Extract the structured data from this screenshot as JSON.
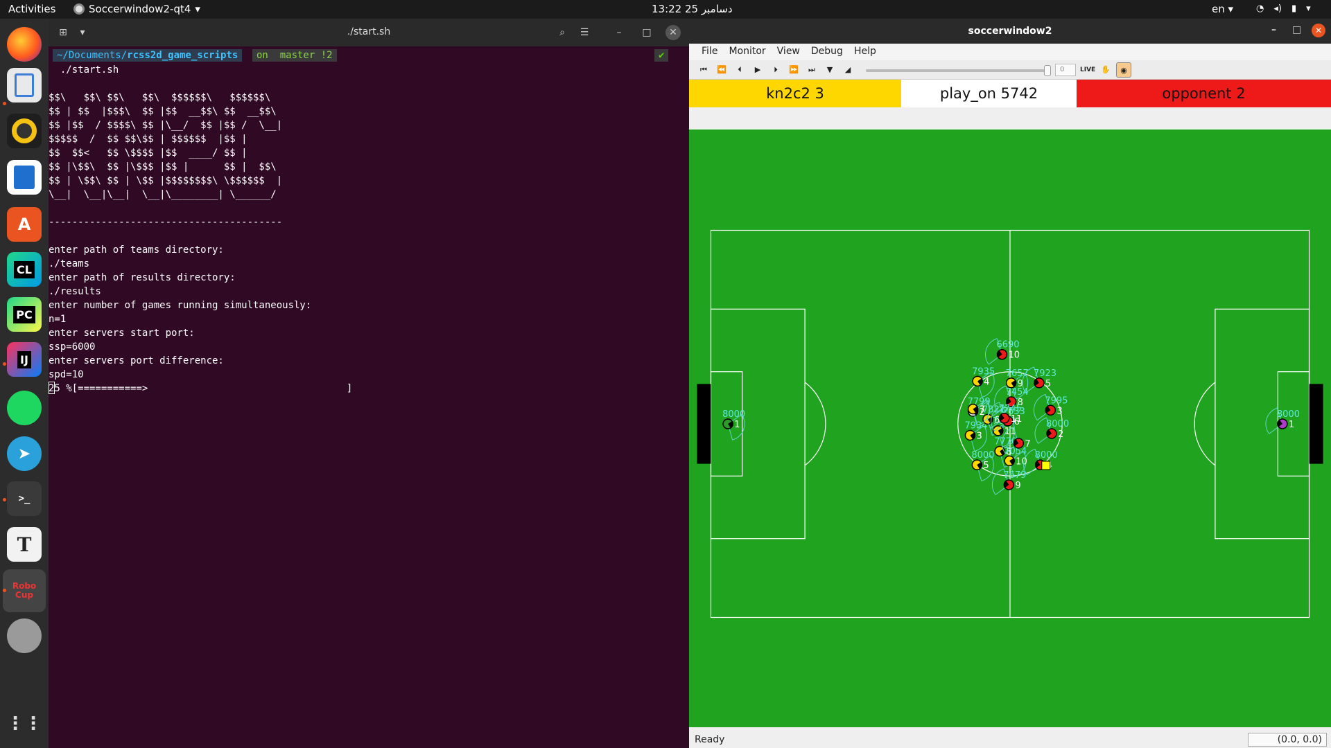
{
  "topbar": {
    "activities": "Activities",
    "app_name": "Soccerwindow2-qt4",
    "clock": "13:22  25 دسامبر",
    "lang": "en"
  },
  "dock": {
    "items": [
      "firefox",
      "files",
      "rhythmbox",
      "libreoffice-writer",
      "app-center",
      "clion",
      "pycharm",
      "intellij",
      "spotify",
      "telegram",
      "terminal",
      "text-editor",
      "robocup",
      "disk"
    ],
    "labels": {
      "clion": "CL",
      "pycharm": "PC",
      "intellij": "IJ",
      "text-editor": "T",
      "robocup": "Robo Cup"
    }
  },
  "terminal": {
    "title": "./start.sh",
    "prompt_path": "~/Documents/",
    "prompt_path_bold": "rcss2d_game_scripts",
    "prompt_branch": "on  master !2",
    "prompt_check": "✔",
    "lines": [
      "  ./start.sh",
      "",
      "$$\\   $$\\ $$\\   $$\\  $$$$$$\\   $$$$$$\\",
      "$$ | $$  |$$$\\  $$ |$$  __$$\\ $$  __$$\\",
      "$$ |$$  / $$$$\\ $$ |\\__/  $$ |$$ /  \\__|",
      "$$$$$  /  $$ $$\\$$ | $$$$$$  |$$ |",
      "$$  $$<   $$ \\$$$$ |$$  ____/ $$ |",
      "$$ |\\$$\\  $$ |\\$$$ |$$ |      $$ |  $$\\",
      "$$ | \\$$\\ $$ | \\$$ |$$$$$$$$\\ \\$$$$$$  |",
      "\\__|  \\__|\\__|  \\__|\\________| \\______/",
      "",
      "----------------------------------------",
      "",
      "enter path of teams directory:",
      "./teams",
      "enter path of results directory:",
      "./results",
      "enter number of games running simultaneously:",
      "n=1",
      "enter servers start port:",
      "ssp=6000",
      "enter servers port difference:",
      "spd=10",
      "25 %[===========>                                  ]"
    ]
  },
  "soccerwindow": {
    "title": "soccerwindow2",
    "menu": [
      "File",
      "Monitor",
      "View",
      "Debug",
      "Help"
    ],
    "slider_value": "0",
    "live_label": "LIVE",
    "left_team": "kn2c2  3",
    "play_mode": "play_on  5742",
    "right_team": "opponent  2",
    "colors": {
      "left": "#ffd700",
      "right": "#ee1a1a",
      "field": "#20a41f"
    },
    "status": "Ready",
    "coords": "(0.0, 0.0)",
    "players": [
      {
        "team": "left",
        "num": "1",
        "stamina": "8000",
        "color": "#2c9b2c",
        "x": -49.5,
        "y": 0.0
      },
      {
        "team": "left",
        "num": "2",
        "stamina": "7799",
        "color": "#ffffff",
        "x": -6.5,
        "y": -2.2
      },
      {
        "team": "left",
        "num": "3",
        "stamina": "7934",
        "color": "#ffd700",
        "x": -7.0,
        "y": 2.0
      },
      {
        "team": "left",
        "num": "4",
        "stamina": "7935",
        "color": "#ffd700",
        "x": -5.7,
        "y": -7.5
      },
      {
        "team": "left",
        "num": "5",
        "stamina": "8000",
        "color": "#ffd700",
        "x": -5.8,
        "y": 7.2
      },
      {
        "team": "left",
        "num": "6",
        "stamina": "7821",
        "color": "#ffd700",
        "x": -3.9,
        "y": -0.8
      },
      {
        "team": "left",
        "num": "7",
        "stamina": "",
        "color": "#ffd700",
        "x": -6.5,
        "y": -2.6
      },
      {
        "team": "left",
        "num": "8",
        "stamina": "7770",
        "color": "#ffd700",
        "x": -1.8,
        "y": 4.8
      },
      {
        "team": "left",
        "num": "9",
        "stamina": "7657",
        "color": "#ffd700",
        "x": 0.2,
        "y": -7.2
      },
      {
        "team": "left",
        "num": "10",
        "stamina": "7054",
        "color": "#ffd700",
        "x": -0.1,
        "y": 6.5
      },
      {
        "team": "left",
        "num": "11",
        "stamina": "7610",
        "color": "#ffd700",
        "x": -2.1,
        "y": 1.2
      },
      {
        "team": "right",
        "num": "1",
        "stamina": "8000",
        "color": "#b03ac9",
        "x": 47.8,
        "y": 0.0
      },
      {
        "team": "right",
        "num": "2",
        "stamina": "8000",
        "color": "#ee1a1a",
        "x": 7.3,
        "y": 1.7
      },
      {
        "team": "right",
        "num": "3",
        "stamina": "7995",
        "color": "#ee1a1a",
        "x": 7.1,
        "y": -2.4
      },
      {
        "team": "right",
        "num": "4",
        "stamina": "8000",
        "color": "#ee1a1a",
        "x": 5.3,
        "y": 7.2
      },
      {
        "team": "right",
        "num": "5",
        "stamina": "7923",
        "color": "#ee1a1a",
        "x": 5.1,
        "y": -7.2
      },
      {
        "team": "right",
        "num": "6",
        "stamina": "7633",
        "color": "#ee1a1a",
        "x": -0.4,
        "y": -0.5
      },
      {
        "team": "right",
        "num": "7",
        "stamina": "",
        "color": "#ee1a1a",
        "x": 1.5,
        "y": 3.4
      },
      {
        "team": "right",
        "num": "8",
        "stamina": "7454",
        "color": "#ee1a1a",
        "x": 0.2,
        "y": -3.9
      },
      {
        "team": "right",
        "num": "9",
        "stamina": "7679",
        "color": "#ee1a1a",
        "x": -0.2,
        "y": 10.7
      },
      {
        "team": "right",
        "num": "10",
        "stamina": "6690",
        "color": "#ee1a1a",
        "x": -1.4,
        "y": -12.2
      },
      {
        "team": "right",
        "num": "11",
        "stamina": "7745",
        "color": "#ee1a1a",
        "x": -1.0,
        "y": -1.0
      }
    ],
    "ball": {
      "x": 6.3,
      "y": 7.3
    }
  }
}
